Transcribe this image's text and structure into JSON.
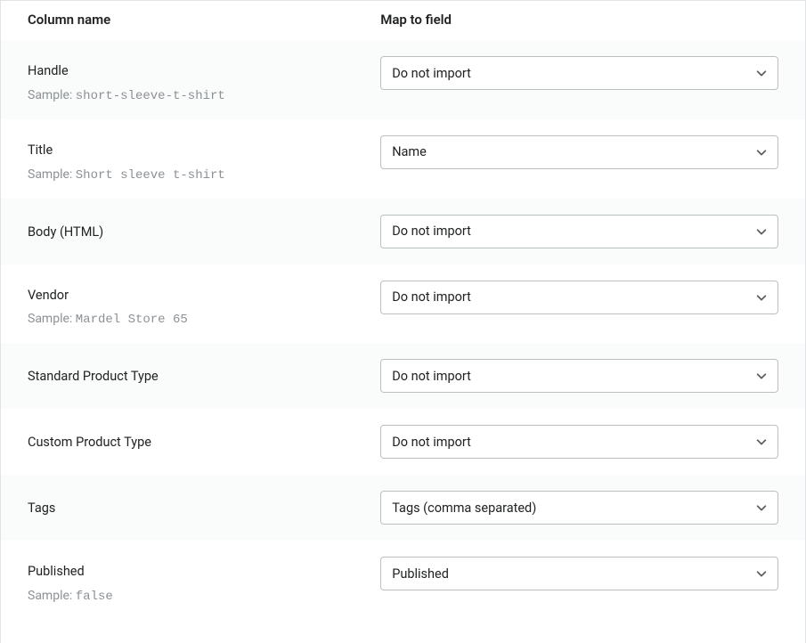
{
  "header": {
    "column_name": "Column name",
    "map_to_field": "Map to field"
  },
  "rows": [
    {
      "name": "Handle",
      "sample_label": "Sample:",
      "sample_value": "short-sleeve-t-shirt",
      "has_sample": true,
      "select_value": "Do not import",
      "alt": true
    },
    {
      "name": "Title",
      "sample_label": "Sample:",
      "sample_value": "Short sleeve t-shirt",
      "has_sample": true,
      "select_value": "Name",
      "alt": false
    },
    {
      "name": "Body (HTML)",
      "has_sample": false,
      "select_value": "Do not import",
      "alt": true
    },
    {
      "name": "Vendor",
      "sample_label": "Sample:",
      "sample_value": "Mardel Store 65",
      "has_sample": true,
      "select_value": "Do not import",
      "alt": false
    },
    {
      "name": "Standard Product Type",
      "has_sample": false,
      "select_value": "Do not import",
      "alt": true
    },
    {
      "name": "Custom Product Type",
      "has_sample": false,
      "select_value": "Do not import",
      "alt": false
    },
    {
      "name": "Tags",
      "has_sample": false,
      "select_value": "Tags (comma separated)",
      "alt": true
    },
    {
      "name": "Published",
      "sample_label": "Sample:",
      "sample_value": "false",
      "has_sample": true,
      "select_value": "Published",
      "alt": false
    }
  ]
}
